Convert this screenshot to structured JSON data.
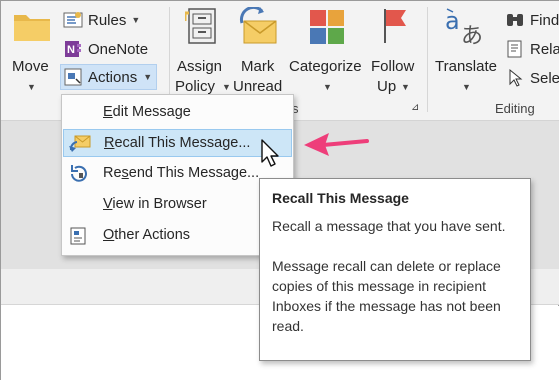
{
  "ribbon": {
    "move": {
      "label": "Move",
      "icon": "folder-icon"
    },
    "rules": {
      "label": "Rules",
      "icon": "rules-icon"
    },
    "onenote": {
      "label": "OneNote",
      "icon": "onenote-icon"
    },
    "actions": {
      "label": "Actions",
      "icon": "actions-icon"
    },
    "assign_policy": {
      "line1": "Assign",
      "line2": "Policy",
      "icon": "policy-cabinet-icon"
    },
    "mark_unread": {
      "line1": "Mark",
      "line2": "Unread",
      "icon": "envelope-unread-icon"
    },
    "categorize": {
      "label": "Categorize",
      "icon": "categorize-icon"
    },
    "follow_up": {
      "line1": "Follow",
      "line2": "Up",
      "icon": "flag-icon"
    },
    "translate": {
      "label": "Translate",
      "icon": "translate-icon"
    },
    "find": {
      "label": "Find",
      "icon": "binoculars-icon"
    },
    "related": {
      "label": "Rela",
      "icon": "related-icon"
    },
    "select": {
      "label": "Sele",
      "icon": "select-cursor-icon"
    },
    "group_tags_marker": "s",
    "group_editing": "Editing"
  },
  "actions_menu": {
    "items": [
      {
        "label": "Edit Message",
        "accel": "E",
        "icon": ""
      },
      {
        "label": "Recall This Message...",
        "accel": "R",
        "icon": "recall-envelope-icon"
      },
      {
        "label": "Resend This Message...",
        "accel": "s",
        "icon": "resend-icon"
      },
      {
        "label": "View in Browser",
        "accel": "V",
        "icon": ""
      },
      {
        "label": "Other Actions",
        "accel": "O",
        "icon": "other-actions-icon"
      }
    ],
    "hovered_index": 1
  },
  "tooltip": {
    "title": "Recall This Message",
    "para1": "Recall a message that you have sent.",
    "para2": "Message recall can delete or replace copies of this message in recipient Inboxes if the message has not been read."
  },
  "colors": {
    "annotation_arrow": "#ee3e7a",
    "hover_bg": "#cde6f7",
    "ribbon_bg": "#f3f3f3"
  }
}
